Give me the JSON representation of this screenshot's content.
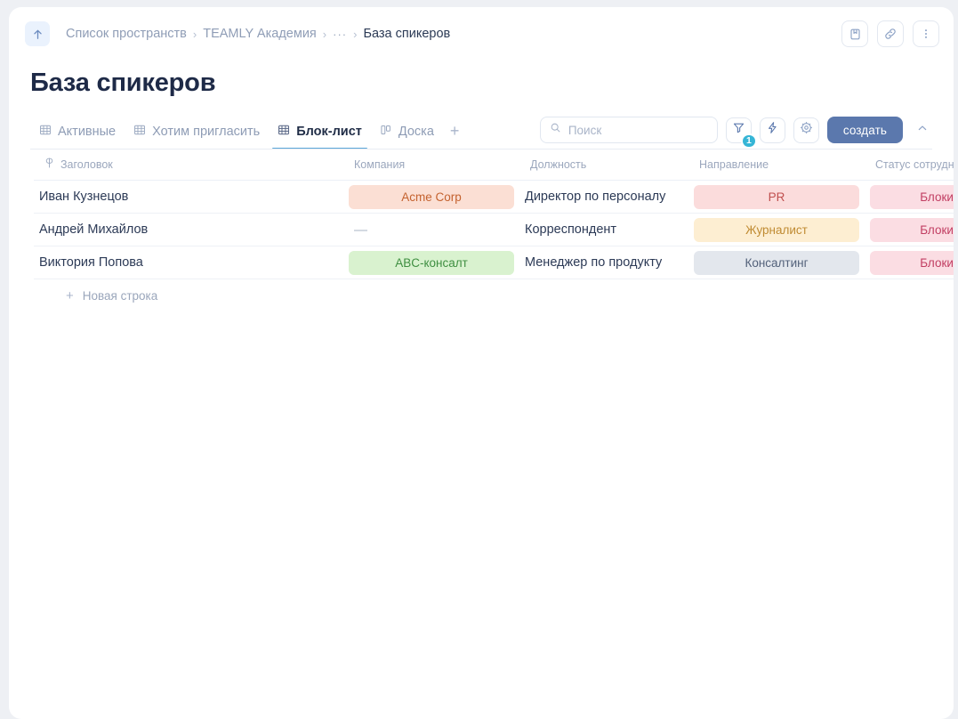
{
  "topbar": {
    "back_icon": "arrow-up-icon",
    "breadcrumb": {
      "items": [
        {
          "label": "Список пространств",
          "current": false
        },
        {
          "label": "TEAMLY Академия",
          "current": false
        },
        {
          "label": "…",
          "current": false
        },
        {
          "label": "База спикеров",
          "current": true
        }
      ],
      "separator": "›",
      "ellipsis": "···"
    },
    "actions": [
      {
        "name": "bookmark-button",
        "icon": "bookmark-icon"
      },
      {
        "name": "share-link-button",
        "icon": "link-icon"
      },
      {
        "name": "more-options-button",
        "icon": "more-vertical-icon"
      }
    ]
  },
  "page": {
    "title": "База спикеров"
  },
  "tabs": [
    {
      "label": "Активные",
      "icon": "table-grid-icon",
      "active": false
    },
    {
      "label": "Хотим пригласить",
      "icon": "table-grid-icon",
      "active": false
    },
    {
      "label": "Блок-лист",
      "icon": "table-grid-icon",
      "active": true
    },
    {
      "label": "Доска",
      "icon": "kanban-board-icon",
      "active": false
    }
  ],
  "tab_add_label": "+",
  "toolbar": {
    "search": {
      "placeholder": "Поиск",
      "value": ""
    },
    "filter": {
      "icon": "filter-icon",
      "badge": "1"
    },
    "automation": {
      "icon": "lightning-icon"
    },
    "settings": {
      "icon": "gear-icon"
    },
    "create_label": "создать",
    "collapse": {
      "icon": "chevron-up-icon"
    }
  },
  "table": {
    "columns": [
      {
        "key": "title",
        "label": "Заголовок",
        "icon": "title-field-icon"
      },
      {
        "key": "company",
        "label": "Компания",
        "icon": ""
      },
      {
        "key": "role",
        "label": "Должность",
        "icon": ""
      },
      {
        "key": "dir",
        "label": "Направление",
        "icon": ""
      },
      {
        "key": "status",
        "label": "Статус сотрудн",
        "icon": ""
      }
    ],
    "rows": [
      {
        "title": "Иван Кузнецов",
        "company": {
          "text": "Acme Corp",
          "style": "peach"
        },
        "role": "Директор по персоналу",
        "dir": {
          "text": "PR",
          "style": "rose"
        },
        "status": {
          "text": "Блокировка",
          "style": "pink"
        }
      },
      {
        "title": "Андрей Михайлов",
        "company": {
          "text": "—",
          "style": "empty"
        },
        "role": "Корреспондент",
        "dir": {
          "text": "Журналист",
          "style": "cream"
        },
        "status": {
          "text": "Блокировка",
          "style": "pink"
        }
      },
      {
        "title": "Виктория Попова",
        "company": {
          "text": "ABC-консалт",
          "style": "green"
        },
        "role": "Менеджер по продукту",
        "dir": {
          "text": "Консалтинг",
          "style": "gray"
        },
        "status": {
          "text": "Блокировка",
          "style": "pink"
        }
      }
    ],
    "new_row_label": "Новая строка"
  },
  "colors": {
    "accent": "#5b78ad",
    "active_tab_underline": "#5ba7d8",
    "badge": "#35b5d6",
    "title": "#1e2a47",
    "muted": "#9ba7bd"
  }
}
